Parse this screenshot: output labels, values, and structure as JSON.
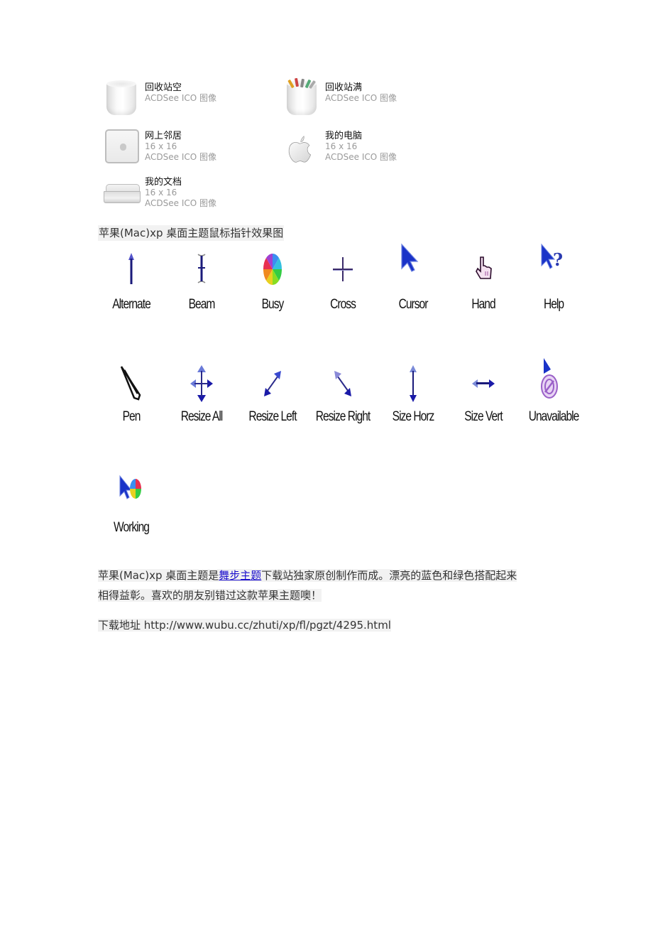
{
  "icon_files": [
    {
      "name": "回收站空",
      "size": null,
      "type": "ACDSee ICO 图像",
      "icon": "empty-trash-icon"
    },
    {
      "name": "回收站满",
      "size": null,
      "type": "ACDSee ICO 图像",
      "icon": "full-trash-icon"
    },
    {
      "name": "网上邻居",
      "size": "16 x 16",
      "type": "ACDSee ICO 图像",
      "icon": "network-neighborhood-icon"
    },
    {
      "name": "我的电脑",
      "size": "16 x 16",
      "type": "ACDSee ICO 图像",
      "icon": "apple-logo-icon"
    },
    {
      "name": "我的文档",
      "size": "16 x 16",
      "type": "ACDSee ICO 图像",
      "icon": "mac-mini-icon"
    }
  ],
  "cursor_caption": "苹果(Mac)xp 桌面主题鼠标指针效果图",
  "cursors": [
    {
      "label": "Alternate",
      "icon": "alternate-arrow-icon"
    },
    {
      "label": "Beam",
      "icon": "text-beam-icon"
    },
    {
      "label": "Busy",
      "icon": "busy-spinner-icon"
    },
    {
      "label": "Cross",
      "icon": "crosshair-icon"
    },
    {
      "label": "Cursor",
      "icon": "pointer-arrow-icon"
    },
    {
      "label": "Hand",
      "icon": "hand-pointer-icon"
    },
    {
      "label": "Help",
      "icon": "help-arrow-icon"
    },
    {
      "label": "Pen",
      "icon": "pen-icon"
    },
    {
      "label": "Resize All",
      "icon": "move-arrows-icon"
    },
    {
      "label": "Resize Left",
      "icon": "diagonal-resize-ne-icon"
    },
    {
      "label": "Resize Right",
      "icon": "diagonal-resize-nw-icon"
    },
    {
      "label": "Size Horz",
      "icon": "vertical-resize-icon"
    },
    {
      "label": "Size Vert",
      "icon": "horizontal-resize-icon"
    },
    {
      "label": "Unavailable",
      "icon": "unavailable-icon"
    },
    {
      "label": "Working",
      "icon": "working-arrow-spinner-icon"
    }
  ],
  "description": {
    "before_link": "苹果(Mac)xp 桌面主题是",
    "link_text": "舞步主题",
    "after_link_line1": "下载站独家原创制作而成。漂亮的蓝色和绿色搭配起来",
    "line2": "相得益彰。喜欢的朋友别错过这款苹果主题噢！"
  },
  "download": {
    "label": "下载地址",
    "url": "http://www.wubu.cc/zhuti/xp/fl/pgzt/4295.html"
  },
  "colors": {
    "link": "#1a0dcc",
    "cursor_blue": "#1a1aa8",
    "text_highlight": "#f2f2f2"
  }
}
